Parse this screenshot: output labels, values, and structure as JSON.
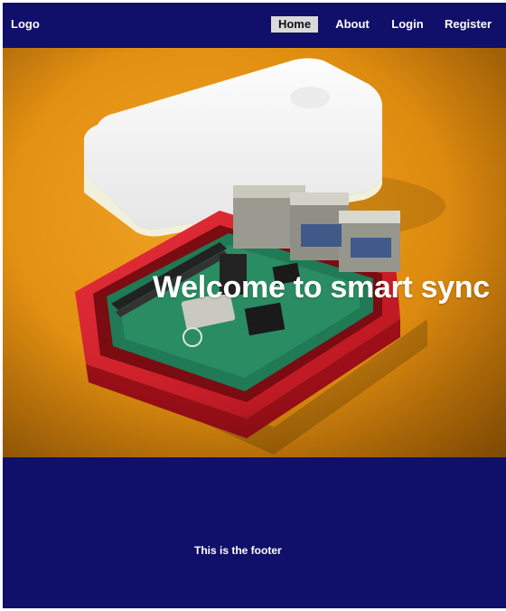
{
  "navbar": {
    "logo": "Logo",
    "links": [
      {
        "label": "Home",
        "active": true
      },
      {
        "label": "About",
        "active": false
      },
      {
        "label": "Login",
        "active": false
      },
      {
        "label": "Register",
        "active": false
      }
    ]
  },
  "hero": {
    "title": "Welcome to smart sync",
    "image": "raspberry-pi-in-case"
  },
  "footer": {
    "text": "This is the footer"
  },
  "colors": {
    "navbar_bg": "#100f69",
    "footer_bg": "#100f69",
    "active_link_bg": "#d9d9d9",
    "hero_bg": "#e39112"
  }
}
